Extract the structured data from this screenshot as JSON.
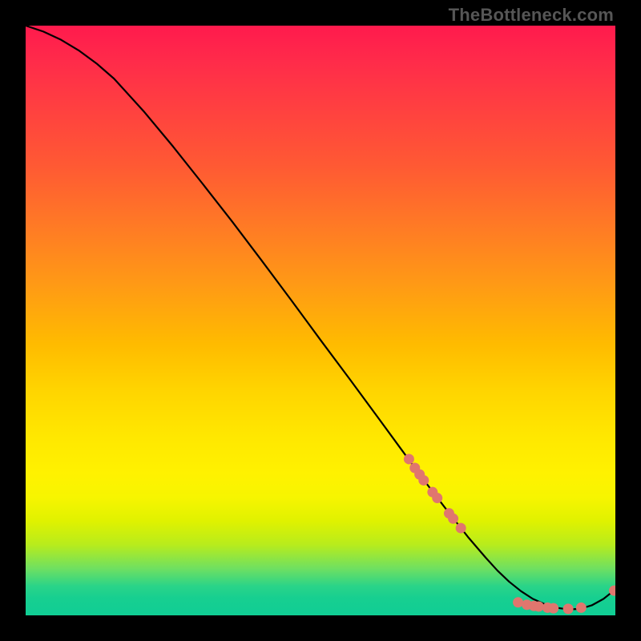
{
  "watermark": "TheBottleneck.com",
  "chart_data": {
    "type": "line",
    "title": "",
    "xlabel": "",
    "ylabel": "",
    "xlim": [
      0,
      100
    ],
    "ylim": [
      0,
      100
    ],
    "series": [
      {
        "name": "curve",
        "x": [
          0,
          3,
          6,
          9,
          12,
          15,
          20,
          25,
          30,
          35,
          40,
          45,
          50,
          55,
          60,
          63,
          66,
          69,
          72,
          75,
          78,
          80,
          82,
          84,
          86,
          88,
          90,
          92,
          94,
          96,
          98,
          100
        ],
        "y": [
          100,
          99.0,
          97.6,
          95.8,
          93.6,
          91.0,
          85.5,
          79.5,
          73.2,
          66.8,
          60.2,
          53.5,
          46.7,
          40.0,
          33.2,
          29.1,
          25.0,
          21.0,
          17.1,
          13.3,
          9.8,
          7.6,
          5.7,
          4.1,
          2.8,
          1.9,
          1.3,
          1.0,
          1.1,
          1.7,
          2.8,
          4.4
        ]
      }
    ],
    "markers": [
      {
        "x": 65.0,
        "y": 26.5
      },
      {
        "x": 66.0,
        "y": 25.0
      },
      {
        "x": 66.8,
        "y": 23.9
      },
      {
        "x": 67.5,
        "y": 22.9
      },
      {
        "x": 69.0,
        "y": 20.9
      },
      {
        "x": 69.8,
        "y": 19.9
      },
      {
        "x": 71.8,
        "y": 17.3
      },
      {
        "x": 72.5,
        "y": 16.4
      },
      {
        "x": 73.8,
        "y": 14.8
      },
      {
        "x": 83.5,
        "y": 2.2
      },
      {
        "x": 85.0,
        "y": 1.8
      },
      {
        "x": 86.2,
        "y": 1.6
      },
      {
        "x": 87.0,
        "y": 1.5
      },
      {
        "x": 88.5,
        "y": 1.3
      },
      {
        "x": 89.5,
        "y": 1.2
      },
      {
        "x": 92.0,
        "y": 1.1
      },
      {
        "x": 94.2,
        "y": 1.3
      },
      {
        "x": 99.8,
        "y": 4.2
      }
    ],
    "marker_color": "#e0766e",
    "curve_color": "#000000"
  }
}
